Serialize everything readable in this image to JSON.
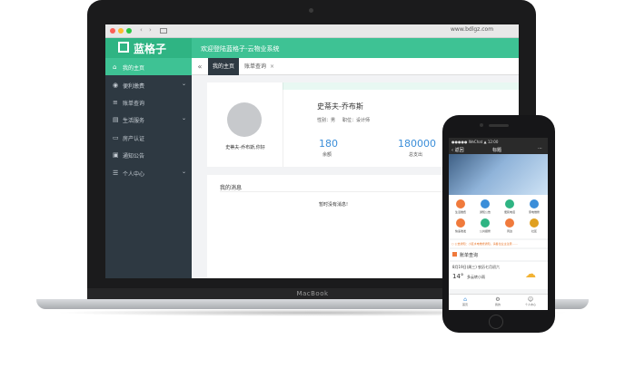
{
  "laptop": {
    "brand": "MacBook"
  },
  "browser": {
    "back": "‹",
    "forward": "›",
    "url": "www.bdlgz.com"
  },
  "app": {
    "logo": "蓝格子",
    "welcome": "欢迎登陆蓝格子-云物业系统",
    "accent_color": "#3ec294",
    "sidebar_color": "#2e3942"
  },
  "sidebar": {
    "items": [
      {
        "label": "我的主页",
        "icon": "home-icon",
        "glyph": "⌂",
        "active": true,
        "chevron": ""
      },
      {
        "label": "便利缴费",
        "icon": "payment-icon",
        "glyph": "◉",
        "active": false,
        "chevron": "⌄"
      },
      {
        "label": "账单查询",
        "icon": "bill-icon",
        "glyph": "≡",
        "active": false,
        "chevron": ""
      },
      {
        "label": "生活服务",
        "icon": "service-icon",
        "glyph": "▤",
        "active": false,
        "chevron": "⌄"
      },
      {
        "label": "房产认证",
        "icon": "house-icon",
        "glyph": "▭",
        "active": false,
        "chevron": ""
      },
      {
        "label": "通知公告",
        "icon": "notice-icon",
        "glyph": "▣",
        "active": false,
        "chevron": ""
      },
      {
        "label": "个人中心",
        "icon": "user-icon",
        "glyph": "☰",
        "active": false,
        "chevron": "⌄"
      }
    ]
  },
  "tabs": {
    "prev": "«",
    "active": "我的主页",
    "second": "账单查询",
    "close": "×"
  },
  "profile": {
    "avatar_name": "史蒂夫-乔布斯,你好",
    "name": "史蒂夫-乔布斯",
    "meta": "性别：男     职位：设计师",
    "stats": [
      {
        "value": "180",
        "label": "余额"
      },
      {
        "value": "180000",
        "label": "总支出"
      }
    ]
  },
  "messages": {
    "title": "我的消息",
    "empty": "暂时没有消息!"
  },
  "phone": {
    "status": "●●●●● WeChat  ▲   12:00",
    "back": "‹ 返回",
    "title": "标题",
    "menu": "⋯",
    "grid": [
      {
        "label": "生活缴费",
        "color": "#f07a3c"
      },
      {
        "label": "通知公告",
        "color": "#3b8ed9"
      },
      {
        "label": "便民电话",
        "color": "#2fb483"
      },
      {
        "label": "家电维修",
        "color": "#3b8ed9"
      },
      {
        "label": "快递收发",
        "color": "#f07a3c"
      },
      {
        "label": "公共报修",
        "color": "#2fb483"
      },
      {
        "label": "周边",
        "color": "#f07a3c"
      },
      {
        "label": "社区",
        "color": "#e0a020"
      }
    ],
    "notice": "○ 公告通知：小区水电维修通知，请各位业主注意……",
    "bill": "账单查询",
    "weather_date": "8月19日(周三)  农历七月初六",
    "weather_temp": "14°",
    "weather_desc": "多云转小雨",
    "tabs": [
      "首页",
      "我的",
      "个人中心"
    ]
  }
}
